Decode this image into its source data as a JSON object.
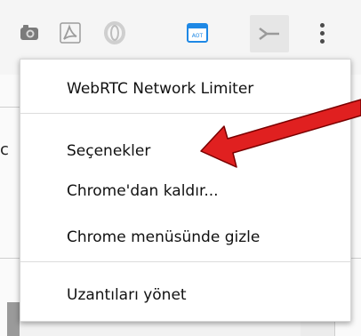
{
  "toolbar": {
    "extension_icons": [
      {
        "icon": "camera-extension-icon"
      },
      {
        "icon": "pdf-extension-icon"
      },
      {
        "icon": "opera-style-extension-icon"
      },
      {
        "icon": "aot-extension-icon",
        "label": "AOT"
      },
      {
        "icon": "webrtc-network-limiter-icon",
        "active": true
      }
    ],
    "menu_icon": "kebab-menu-icon"
  },
  "menu": {
    "title": "WebRTC Network Limiter",
    "items": [
      "Seçenekler",
      "Chrome'dan kaldır...",
      "Chrome menüsünde gizle"
    ],
    "manage": "Uzantıları yönet"
  },
  "background": {
    "cut_text": "c"
  },
  "colors": {
    "arrow": "#e02020",
    "menu_bg": "#ffffff",
    "aot_blue": "#1e88e5"
  }
}
